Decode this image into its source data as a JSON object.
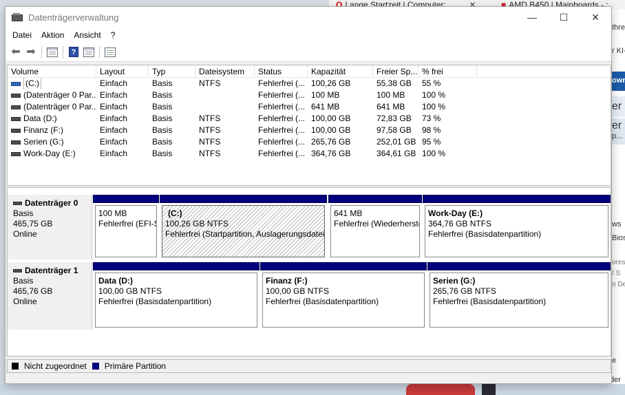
{
  "background": {
    "tab1_title": "Lange Startzeit | Computer:",
    "tab2_title": "AMD B450 | Mainboards - :",
    "fragments": [
      "thre",
      "r KI-",
      "owr",
      "er",
      "er",
      "p...",
      "ws",
      "Bios",
      "ores",
      "/ S",
      "n De",
      "e",
      "der",
      "-"
    ]
  },
  "window": {
    "title": "Datenträgerverwaltung",
    "controls": {
      "minimize": "—",
      "maximize": "☐",
      "close": "✕"
    }
  },
  "menu": [
    "Datei",
    "Aktion",
    "Ansicht",
    "?"
  ],
  "toolbar": {
    "icons": [
      "back-arrow-icon",
      "forward-arrow-icon",
      "show-hide-tree-icon",
      "help-icon",
      "disk-list-icon",
      "properties-icon"
    ]
  },
  "volume_list": {
    "headers": [
      "Volume",
      "Layout",
      "Typ",
      "Dateisystem",
      "Status",
      "Kapazität",
      "Freier Sp...",
      "% frei"
    ],
    "rows": [
      {
        "volume": "(C:)",
        "layout": "Einfach",
        "typ": "Basis",
        "fs": "NTFS",
        "status": "Fehlerfrei (...",
        "cap": "100,26 GB",
        "free": "55,38 GB",
        "pct": "55 %"
      },
      {
        "volume": "(Datenträger 0 Par...",
        "layout": "Einfach",
        "typ": "Basis",
        "fs": "",
        "status": "Fehlerfrei (...",
        "cap": "100 MB",
        "free": "100 MB",
        "pct": "100 %"
      },
      {
        "volume": "(Datenträger 0 Par...",
        "layout": "Einfach",
        "typ": "Basis",
        "fs": "",
        "status": "Fehlerfrei (...",
        "cap": "641 MB",
        "free": "641 MB",
        "pct": "100 %"
      },
      {
        "volume": "Data (D:)",
        "layout": "Einfach",
        "typ": "Basis",
        "fs": "NTFS",
        "status": "Fehlerfrei (...",
        "cap": "100,00 GB",
        "free": "72,83 GB",
        "pct": "73 %"
      },
      {
        "volume": "Finanz (F:)",
        "layout": "Einfach",
        "typ": "Basis",
        "fs": "NTFS",
        "status": "Fehlerfrei (...",
        "cap": "100,00 GB",
        "free": "97,58 GB",
        "pct": "98 %"
      },
      {
        "volume": "Serien (G:)",
        "layout": "Einfach",
        "typ": "Basis",
        "fs": "NTFS",
        "status": "Fehlerfrei (...",
        "cap": "265,76 GB",
        "free": "252,01 GB",
        "pct": "95 %"
      },
      {
        "volume": "Work-Day (E:)",
        "layout": "Einfach",
        "typ": "Basis",
        "fs": "NTFS",
        "status": "Fehlerfrei (...",
        "cap": "364,76 GB",
        "free": "364,61 GB",
        "pct": "100 %"
      }
    ]
  },
  "disks": [
    {
      "name": "Datenträger 0",
      "type": "Basis",
      "size": "465,75 GB",
      "status": "Online",
      "partitions": [
        {
          "name": "",
          "size": "100 MB",
          "status": "Fehlerfrei (EFI-S"
        },
        {
          "name": "(C:)",
          "size": "100,26 GB NTFS",
          "status": "Fehlerfrei (Startpartition, Auslagerungsdatei"
        },
        {
          "name": "",
          "size": "641 MB",
          "status": "Fehlerfrei (Wiederherste"
        },
        {
          "name": "Work-Day  (E:)",
          "size": "364,76 GB NTFS",
          "status": "Fehlerfrei (Basisdatenpartition)"
        }
      ]
    },
    {
      "name": "Datenträger 1",
      "type": "Basis",
      "size": "465,76 GB",
      "status": "Online",
      "partitions": [
        {
          "name": "Data  (D:)",
          "size": "100,00 GB NTFS",
          "status": "Fehlerfrei (Basisdatenpartition)"
        },
        {
          "name": "Finanz  (F:)",
          "size": "100,00 GB NTFS",
          "status": "Fehlerfrei (Basisdatenpartition)"
        },
        {
          "name": "Serien  (G:)",
          "size": "265,76 GB NTFS",
          "status": "Fehlerfrei (Basisdatenpartition)"
        }
      ]
    }
  ],
  "legend": [
    {
      "label": "Nicht zugeordnet",
      "color": "#000000"
    },
    {
      "label": "Primäre Partition",
      "color": "#00007f"
    }
  ]
}
